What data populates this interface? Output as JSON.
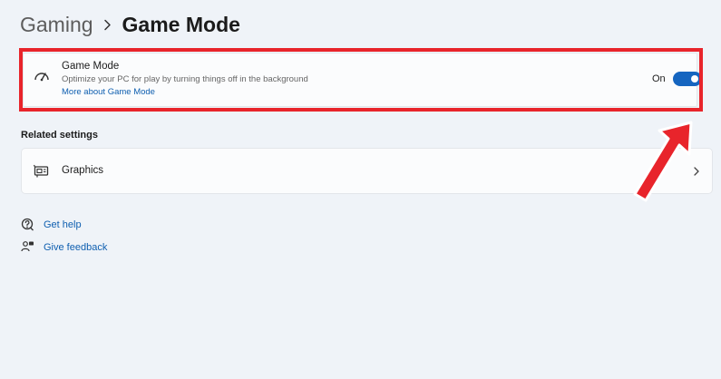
{
  "breadcrumb": {
    "parent": "Gaming",
    "current": "Game Mode"
  },
  "game_mode": {
    "title": "Game Mode",
    "description": "Optimize your PC for play by turning things off in the background",
    "link": "More about Game Mode",
    "toggle_label": "On",
    "toggle_on": true
  },
  "related": {
    "heading": "Related settings",
    "items": [
      {
        "label": "Graphics",
        "icon": "graphics-card-icon"
      }
    ]
  },
  "help": {
    "items": [
      {
        "label": "Get help",
        "icon": "get-help-icon"
      },
      {
        "label": "Give feedback",
        "icon": "feedback-icon"
      }
    ]
  },
  "colors": {
    "accent": "#1565c0",
    "link": "#0f5fb0",
    "annotation": "#e8242b",
    "background": "#eff3f8"
  }
}
